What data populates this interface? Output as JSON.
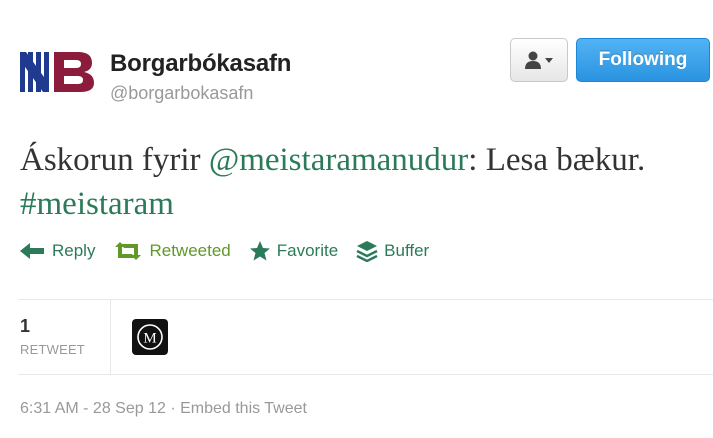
{
  "author": {
    "display_name": "Borgarbókasafn",
    "screen_name": "@borgarbokasafn"
  },
  "buttons": {
    "follow_label": "Following"
  },
  "tweet": {
    "prefix": "Áskorun fyrir ",
    "mention": "@meistaramanudur",
    "middle": ": Lesa bækur. ",
    "hashtag": "#meistaram"
  },
  "actions": {
    "reply": "Reply",
    "retweeted": "Retweeted",
    "favorite": "Favorite",
    "buffer": "Buffer"
  },
  "stats": {
    "retweet_count": "1",
    "retweet_label": "RETWEET"
  },
  "meta": {
    "timestamp": "6:31 AM - 28 Sep 12",
    "separator": " · ",
    "embed_label": "Embed this Tweet"
  },
  "colors": {
    "link": "#2b7b5a",
    "retweeted": "#609928",
    "follow_button": "#2a93e0",
    "logo_blue": "#1f3a8f",
    "logo_maroon": "#8b1c3c"
  },
  "icons": {
    "reply": "reply-arrow-icon",
    "retweet": "retweet-icon",
    "favorite": "star-icon",
    "buffer": "stack-icon",
    "user_menu": "person-icon"
  }
}
